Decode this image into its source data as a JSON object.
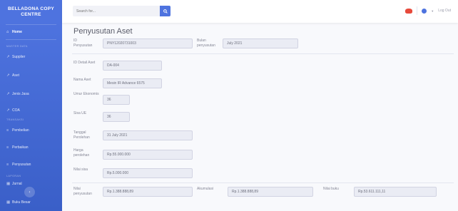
{
  "sidebar": {
    "brand": "BELLADONA COPY\nCENTRE",
    "home": "Home",
    "heading_master": "MASTER DATA",
    "supplier": "Supplier",
    "aset": "Aset",
    "jenis_jasa": "Jenis Jasa",
    "coa": "COA",
    "heading_transaksi": "TRANSAKSI",
    "pembelian": "Pembelian",
    "perbaikan": "Perbaikan",
    "penyusutan": "Penyusutan",
    "heading_laporan": "LAPORAN",
    "jurnal": "Jurnal",
    "buku_besar": "Buku Besar"
  },
  "topbar": {
    "search_placeholder": "Search for...",
    "logout": "Log Out"
  },
  "page": {
    "title": "Penyusutan Aset",
    "id_penyusutan_label": "ID Penyusutan",
    "id_penyusutan_value": "PNY12020731003",
    "bulan_label": "Bulan penyusutan",
    "bulan_value": "July 2021",
    "id_detail_label": "ID Detail Aset",
    "id_detail_value": "DA-004",
    "nama_aset_label": "Nama Aset",
    "nama_aset_value": "Mesin IR Advance 6575",
    "umur_label": "Umur Ekonomis",
    "umur_value": "36",
    "sisa_label": "Sisa UE",
    "sisa_value": "36",
    "tgl_label": "Tanggal Perolehan",
    "tgl_value": "31 July 2021",
    "harga_label": "Harga perolehan",
    "harga_value": "Rp.55.000.000",
    "nilai_sisa_label": "Nilai sisa",
    "nilai_sisa_value": "Rp.5.000.000",
    "nilai_peny_label": "Nilai penyusutan",
    "nilai_peny_value": "Rp.1.388.888,89",
    "akumulasi_label": "Akumulasi",
    "akumulasi_value": "Rp.1.388.888,89",
    "nilai_buku_label": "Nilai buku",
    "nilai_buku_value": "Rp.53.611.111,11"
  }
}
